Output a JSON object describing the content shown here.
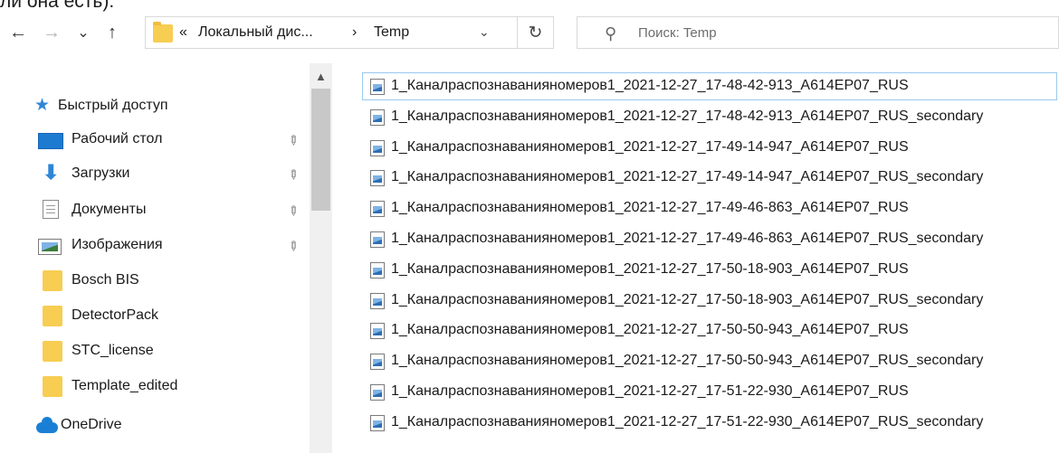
{
  "caption": "ли она есть).",
  "nav": {
    "back_glyph": "←",
    "forward_glyph": "→",
    "recent_glyph": "⌄",
    "up_glyph": "↑"
  },
  "address": {
    "overflow": "«",
    "crumb1": "Локальный дис...",
    "separator": "›",
    "crumb2": "Temp",
    "dropdown_glyph": "⌄",
    "refresh_glyph": "↻"
  },
  "search": {
    "icon_glyph": "⚲",
    "placeholder": "Поиск: Temp"
  },
  "sidebar": {
    "quick_access": "Быстрый доступ",
    "items": [
      {
        "label": "Рабочий стол"
      },
      {
        "label": "Загрузки"
      },
      {
        "label": "Документы"
      },
      {
        "label": "Изображения"
      },
      {
        "label": "Bosch BIS"
      },
      {
        "label": "DetectorPack"
      },
      {
        "label": "STC_license"
      },
      {
        "label": "Template_edited"
      }
    ],
    "onedrive": "OneDrive",
    "pin_glyph": "📌"
  },
  "files": [
    "1_Каналраспознаванияномеров1_2021-12-27_17-48-42-913_A614EP07_RUS",
    "1_Каналраспознаванияномеров1_2021-12-27_17-48-42-913_A614EP07_RUS_secondary",
    "1_Каналраспознаванияномеров1_2021-12-27_17-49-14-947_A614EP07_RUS",
    "1_Каналраспознаванияномеров1_2021-12-27_17-49-14-947_A614EP07_RUS_secondary",
    "1_Каналраспознаванияномеров1_2021-12-27_17-49-46-863_A614EP07_RUS",
    "1_Каналраспознаванияномеров1_2021-12-27_17-49-46-863_A614EP07_RUS_secondary",
    "1_Каналраспознаванияномеров1_2021-12-27_17-50-18-903_A614EP07_RUS",
    "1_Каналраспознаванияномеров1_2021-12-27_17-50-18-903_A614EP07_RUS_secondary",
    "1_Каналраспознаванияномеров1_2021-12-27_17-50-50-943_A614EP07_RUS",
    "1_Каналраспознаванияномеров1_2021-12-27_17-50-50-943_A614EP07_RUS_secondary",
    "1_Каналраспознаванияномеров1_2021-12-27_17-51-22-930_A614EP07_RUS",
    "1_Каналраспознаванияномеров1_2021-12-27_17-51-22-930_A614EP07_RUS_secondary"
  ]
}
